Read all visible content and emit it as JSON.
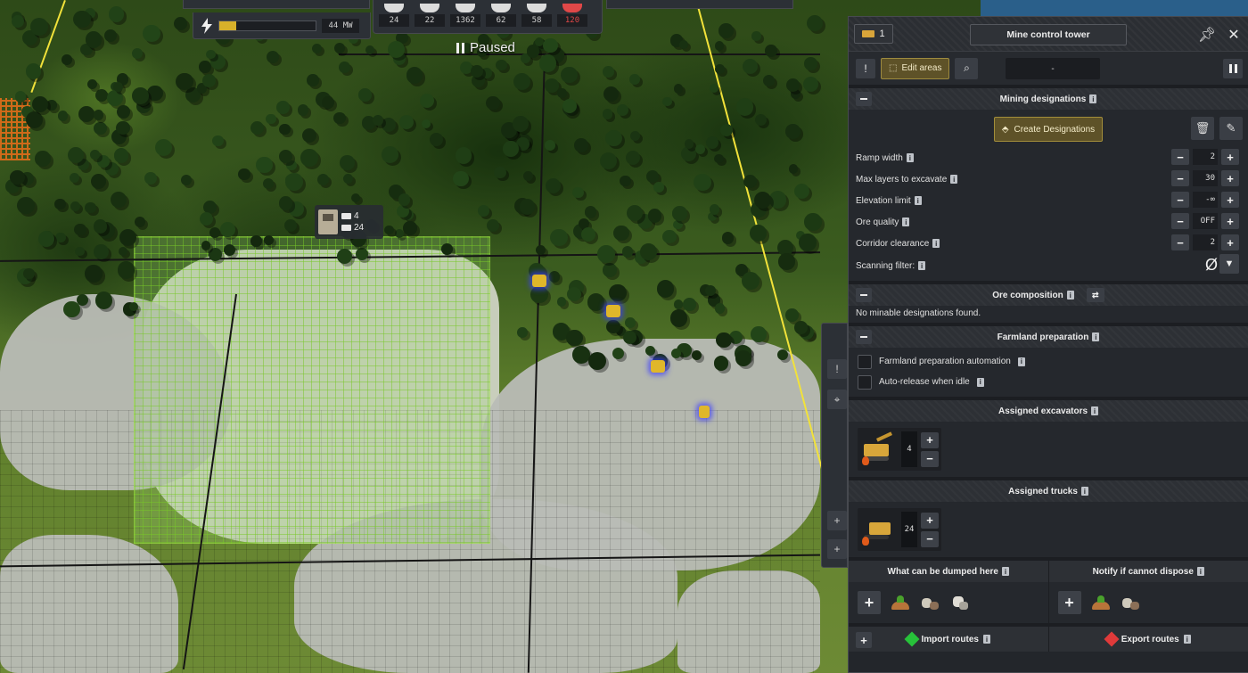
{
  "hud": {
    "power": {
      "value": "44 MW",
      "fill_percent": 18
    },
    "stats": [
      "24",
      "22",
      "1362",
      "62",
      "58",
      "120"
    ],
    "alert_color": "#e04848",
    "paused_label": "Paused"
  },
  "map": {
    "tooltip": {
      "excavators": "4",
      "trucks": "24"
    }
  },
  "panel": {
    "header": {
      "badge_count": "1",
      "title": "Mine control tower"
    },
    "toolbar": {
      "edit_areas": "Edit areas",
      "field_value": "-"
    },
    "mining": {
      "title": "Mining designations",
      "create_label": "Create Designations",
      "params": [
        {
          "label": "Ramp width",
          "value": "2"
        },
        {
          "label": "Max layers to excavate",
          "value": "30"
        },
        {
          "label": "Elevation limit",
          "value": "-∞"
        },
        {
          "label": "Ore quality",
          "value": "OFF"
        },
        {
          "label": "Corridor clearance",
          "value": "2"
        }
      ],
      "filter_label": "Scanning filter:",
      "filter_value": "Ø"
    },
    "ore": {
      "title": "Ore composition",
      "empty": "No minable designations found."
    },
    "farmland": {
      "title": "Farmland preparation",
      "options": [
        "Farmland preparation automation",
        "Auto-release when idle"
      ]
    },
    "excavators": {
      "title": "Assigned excavators",
      "count": "4"
    },
    "trucks": {
      "title": "Assigned trucks",
      "count": "24"
    },
    "dump": {
      "left_title": "What can be dumped here",
      "right_title": "Notify if cannot dispose"
    },
    "routes": {
      "import": "Import routes",
      "export": "Export routes"
    },
    "colors": {
      "accent_gold": "#a38e3a",
      "import_gem": "#27c23a",
      "export_gem": "#e03a3a"
    }
  }
}
